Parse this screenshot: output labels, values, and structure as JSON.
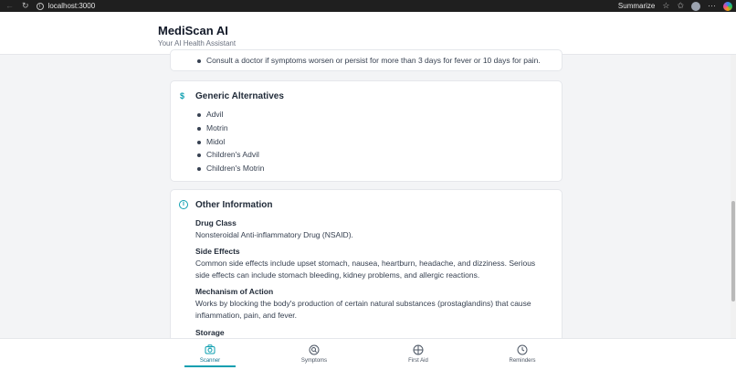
{
  "browser": {
    "url": "localhost:3000",
    "summarize_label": "Summarize"
  },
  "header": {
    "title": "MediScan AI",
    "subtitle": "Your AI Health Assistant"
  },
  "precautions": {
    "last_item": "Consult a doctor if symptoms worsen or persist for more than 3 days for fever or 10 days for pain."
  },
  "generic_alternatives": {
    "icon_glyph": "$",
    "heading": "Generic Alternatives",
    "items": [
      "Advil",
      "Motrin",
      "Midol",
      "Children's Advil",
      "Children's Motrin"
    ]
  },
  "other_information": {
    "icon_glyph": "i",
    "heading": "Other Information",
    "drug_class_label": "Drug Class",
    "drug_class": "Nonsteroidal Anti-inflammatory Drug (NSAID).",
    "side_effects_label": "Side Effects",
    "side_effects": "Common side effects include upset stomach, nausea, heartburn, headache, and dizziness. Serious side effects can include stomach bleeding, kidney problems, and allergic reactions.",
    "mechanism_label": "Mechanism of Action",
    "mechanism": "Works by blocking the body's production of certain natural substances (prostaglandins) that cause inflammation, pain, and fever.",
    "storage_label": "Storage"
  },
  "bottom_nav": {
    "scanner": "Scanner",
    "symptoms": "Symptoms",
    "first_aid": "First Aid",
    "reminders": "Reminders",
    "active": "scanner"
  },
  "colors": {
    "accent": "#0e9fb0",
    "text": "#1f2937",
    "muted": "#6b7280"
  }
}
